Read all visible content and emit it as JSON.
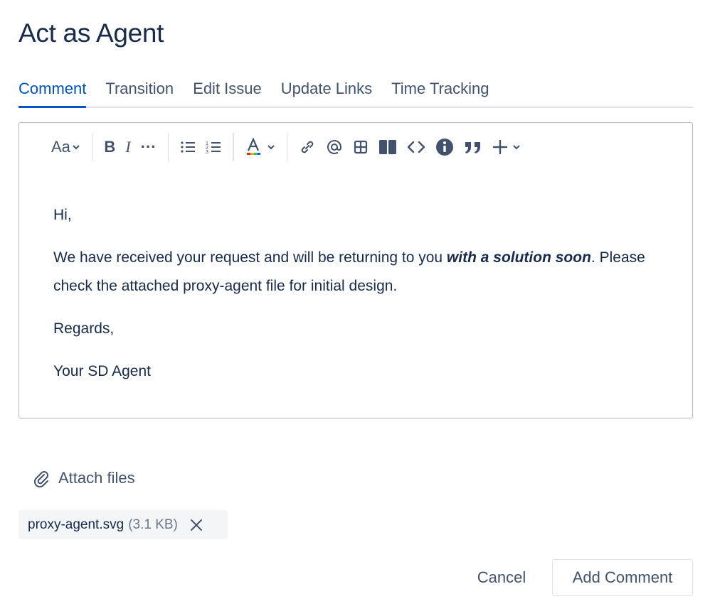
{
  "dialog": {
    "title": "Act as Agent"
  },
  "tabs": [
    {
      "label": "Comment",
      "active": true
    },
    {
      "label": "Transition"
    },
    {
      "label": "Edit Issue"
    },
    {
      "label": "Update Links"
    },
    {
      "label": "Time Tracking"
    }
  ],
  "toolbar": {
    "text_style": "Aa",
    "bold": "B",
    "italic": "I",
    "more": "···",
    "icons": [
      "text-style-icon",
      "bold-icon",
      "italic-icon",
      "more-icon",
      "bullet-list-icon",
      "numbered-list-icon",
      "text-color-icon",
      "link-icon",
      "mention-icon",
      "table-icon",
      "layout-icon",
      "code-icon",
      "info-icon",
      "quote-icon",
      "insert-plus-icon"
    ]
  },
  "editor": {
    "greeting": "Hi,",
    "body_prefix": "We have received your request and will be returning to you ",
    "body_emphasis": "with a solution soon",
    "body_suffix": ".  Please check the attached proxy-agent file for initial design.",
    "closing": "Regards,",
    "signature": "Your SD Agent"
  },
  "attach": {
    "label": "Attach files"
  },
  "file": {
    "name": "proxy-agent.svg",
    "size": "(3.1 KB)"
  },
  "actions": {
    "cancel": "Cancel",
    "submit": "Add Comment"
  },
  "colors": {
    "accent": "#0052cc",
    "text": "#172b4d",
    "muted": "#42526e",
    "border": "#dfe1e6"
  }
}
